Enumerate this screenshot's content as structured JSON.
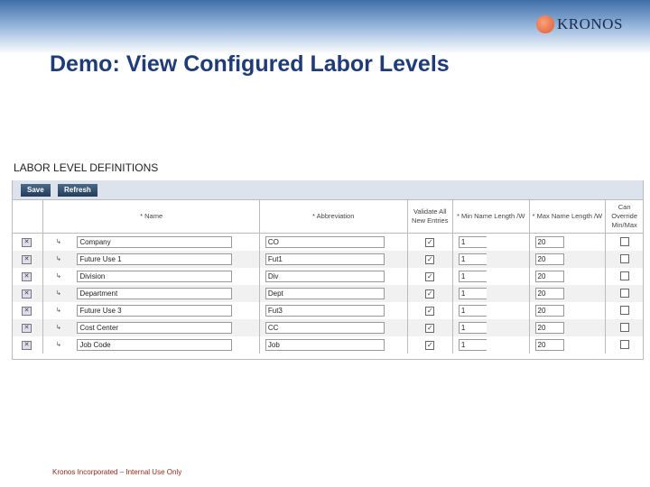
{
  "brand": "KRONOS",
  "title": "Demo: View Configured Labor Levels",
  "section": "LABOR LEVEL DEFINITIONS",
  "toolbar": {
    "save": "Save",
    "refresh": "Refresh"
  },
  "columns": {
    "name": "* Name",
    "abbr": "* Abbreviation",
    "validate": "Validate All New Entries",
    "min": "* Min Name Length /W",
    "max": "* Max Name Length /W",
    "override": "Can Override Min/Max"
  },
  "rows": [
    {
      "name": "Company",
      "abbr": "CO",
      "validate": true,
      "min": "1",
      "max": "20",
      "override": false
    },
    {
      "name": "Future Use 1",
      "abbr": "Fut1",
      "validate": true,
      "min": "1",
      "max": "20",
      "override": false
    },
    {
      "name": "Division",
      "abbr": "Div",
      "validate": true,
      "min": "1",
      "max": "20",
      "override": false
    },
    {
      "name": "Department",
      "abbr": "Dept",
      "validate": true,
      "min": "1",
      "max": "20",
      "override": false
    },
    {
      "name": "Future Use 3",
      "abbr": "Fut3",
      "validate": true,
      "min": "1",
      "max": "20",
      "override": false
    },
    {
      "name": "Cost Center",
      "abbr": "CC",
      "validate": true,
      "min": "1",
      "max": "20",
      "override": false
    },
    {
      "name": "Job Code",
      "abbr": "Job",
      "validate": true,
      "min": "1",
      "max": "20",
      "override": false
    }
  ],
  "footer": "Kronos Incorporated – Internal Use Only"
}
